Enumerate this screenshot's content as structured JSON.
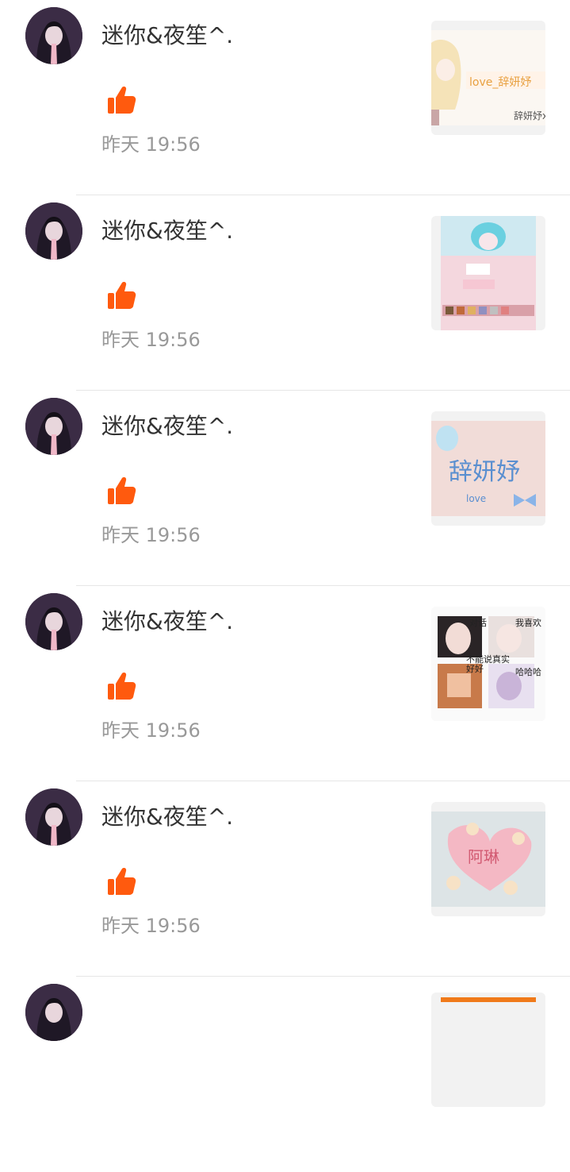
{
  "accent_color": "#ff5a0e",
  "items": [
    {
      "username": "迷你&夜笙^.",
      "time": "昨天 19:56",
      "avatar_icon": "avatar",
      "reaction_icon": "thumbs-up-icon",
      "thumbnail": {
        "texts": [
          "love_辞妍妤",
          "辞妍妤x"
        ]
      }
    },
    {
      "username": "迷你&夜笙^.",
      "time": "昨天 19:56",
      "avatar_icon": "avatar",
      "reaction_icon": "thumbs-up-icon",
      "thumbnail": {
        "texts": []
      }
    },
    {
      "username": "迷你&夜笙^.",
      "time": "昨天 19:56",
      "avatar_icon": "avatar",
      "reaction_icon": "thumbs-up-icon",
      "thumbnail": {
        "texts": [
          "辞妍妤",
          "love"
        ]
      }
    },
    {
      "username": "迷你&夜笙^.",
      "time": "昨天 19:56",
      "avatar_icon": "avatar",
      "reaction_icon": "thumbs-up-icon",
      "thumbnail": {
        "texts": [
          "对话",
          "我喜欢",
          "不能说真实",
          "好好",
          "哈哈哈"
        ]
      }
    },
    {
      "username": "迷你&夜笙^.",
      "time": "昨天 19:56",
      "avatar_icon": "avatar",
      "reaction_icon": "thumbs-up-icon",
      "thumbnail": {
        "texts": [
          "阿琳"
        ]
      }
    }
  ]
}
